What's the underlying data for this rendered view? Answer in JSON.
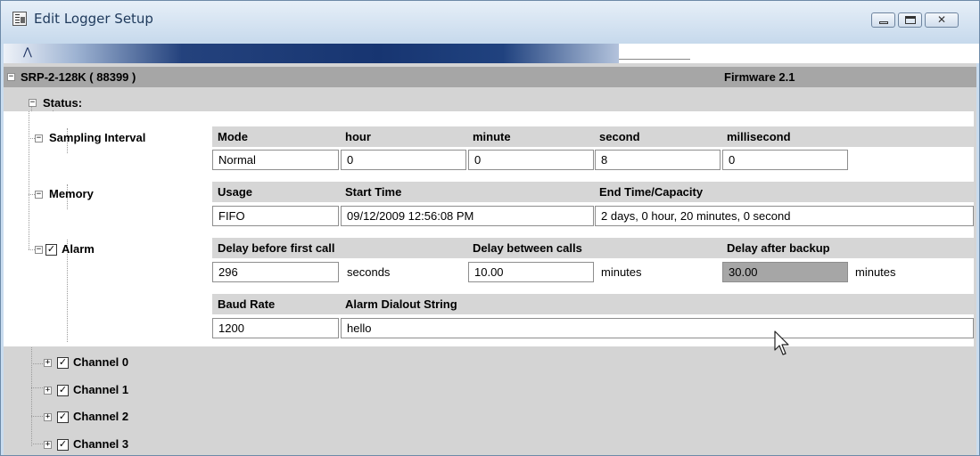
{
  "window": {
    "title": "Edit Logger Setup",
    "minimize_label": "Minimize",
    "maximize_label": "Maximize",
    "close_glyph": "✕"
  },
  "root": {
    "toggle": "−",
    "device": "SRP-2-128K ( 88399 )",
    "firmware": "Firmware 2.1"
  },
  "status": {
    "toggle": "−",
    "label": "Status:"
  },
  "sampling": {
    "toggle": "−",
    "label": "Sampling Interval",
    "headers": [
      "Mode",
      "hour",
      "minute",
      "second",
      "millisecond"
    ],
    "values": [
      "Normal",
      "0",
      "0",
      "8",
      "0"
    ]
  },
  "memory": {
    "toggle": "−",
    "label": "Memory",
    "headers": {
      "usage": "Usage",
      "start": "Start Time",
      "end": "End Time/Capacity"
    },
    "values": {
      "usage": "FIFO",
      "start": "09/12/2009 12:56:08 PM",
      "end": "2 days, 0 hour, 20 minutes, 0 second"
    }
  },
  "alarm": {
    "toggle": "−",
    "checked": true,
    "check_glyph": "✓",
    "label": "Alarm",
    "headers": {
      "first_call": "Delay before first call",
      "between": "Delay between calls",
      "after_backup": "Delay after backup"
    },
    "values": {
      "first_call": "296",
      "first_call_unit": "seconds",
      "between": "10.00",
      "between_unit": "minutes",
      "after_backup": "30.00",
      "after_backup_unit": "minutes"
    },
    "dial_headers": {
      "baud": "Baud Rate",
      "dialout": "Alarm Dialout String"
    },
    "dial_values": {
      "baud": "1200",
      "dialout": "hello"
    }
  },
  "channels": [
    {
      "toggle": "+",
      "checked": true,
      "label": "Channel 0"
    },
    {
      "toggle": "+",
      "checked": true,
      "label": "Channel 1"
    },
    {
      "toggle": "+",
      "checked": true,
      "label": "Channel 2"
    },
    {
      "toggle": "+",
      "checked": true,
      "label": "Channel 3"
    }
  ],
  "colors": {
    "title_bar": "#c6d9ec",
    "root_bar": "#a6a6a6",
    "panel_background": "#d4d4d4",
    "disabled_field": "#a6a6a6"
  }
}
